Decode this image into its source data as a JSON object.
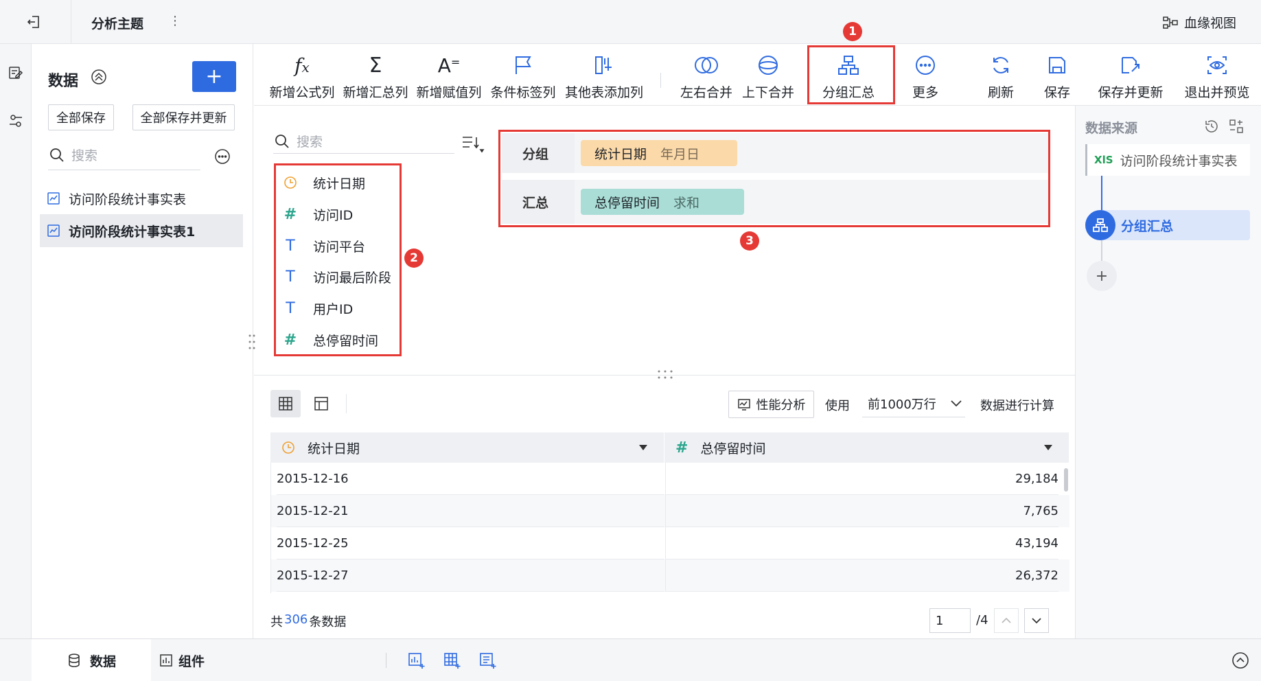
{
  "topbar": {
    "title": "分析主题",
    "more": "⋮",
    "lineage": "血缘视图"
  },
  "left": {
    "heading": "数据",
    "add": "+",
    "save_all": "全部保存",
    "save_all_update": "全部保存并更新",
    "search_placeholder": "搜索",
    "tables": [
      {
        "label": "访问阶段统计事实表",
        "selected": false
      },
      {
        "label": "访问阶段统计事实表1",
        "selected": true
      }
    ]
  },
  "toolbar": {
    "add_formula": "新增公式列",
    "add_summary": "新增汇总列",
    "add_assign": "新增赋值列",
    "condition_tag": "条件标签列",
    "other_table": "其他表添加列",
    "lr_merge": "左右合并",
    "ud_merge": "上下合并",
    "group_summary": "分组汇总",
    "more": "更多",
    "refresh": "刷新",
    "save": "保存",
    "save_update": "保存并更新",
    "exit_preview": "退出并预览"
  },
  "fields": {
    "search_placeholder": "搜索",
    "items": [
      {
        "label": "统计日期",
        "type": "date"
      },
      {
        "label": "访问ID",
        "type": "number"
      },
      {
        "label": "访问平台",
        "type": "text"
      },
      {
        "label": "访问最后阶段",
        "type": "text"
      },
      {
        "label": "用户ID",
        "type": "text"
      },
      {
        "label": "总停留时间",
        "type": "number"
      }
    ]
  },
  "config": {
    "group_label": "分组",
    "group_field": "统计日期",
    "group_mode": "年月日",
    "summary_label": "汇总",
    "summary_field": "总停留时间",
    "summary_mode": "求和"
  },
  "annotations": {
    "b1": "1",
    "b2": "2",
    "b3": "3"
  },
  "preview": {
    "perf": "性能分析",
    "use": "使用",
    "rows_option": "前1000万行",
    "calc": "数据进行计算",
    "columns": [
      {
        "label": "统计日期",
        "type": "date"
      },
      {
        "label": "总停留时间",
        "type": "number"
      }
    ],
    "rows": [
      [
        "2015-12-16",
        "29,184"
      ],
      [
        "2015-12-21",
        "7,765"
      ],
      [
        "2015-12-25",
        "43,194"
      ],
      [
        "2015-12-27",
        "26,372"
      ]
    ],
    "total_prefix": "共",
    "total_count": "306",
    "total_suffix": "条数据",
    "page_value": "1",
    "page_total": "/4"
  },
  "right": {
    "title": "数据来源",
    "xls_badge": "XlS",
    "source": "访问阶段统计事实表",
    "step": "分组汇总",
    "add": "+"
  },
  "bottom": {
    "data_tab": "数据",
    "component_tab": "组件"
  },
  "colors": {
    "primary": "#2f6be0",
    "date_icon": "#f0a030",
    "number_icon": "#2ca58d",
    "group_pill": "#fbd9a9",
    "summary_pill": "#a9ddd6",
    "annotation": "#e53935"
  }
}
